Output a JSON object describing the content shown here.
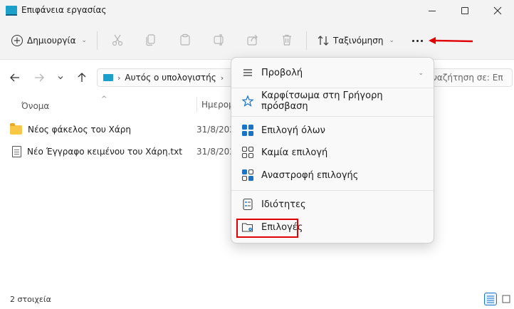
{
  "window": {
    "title": "Επιφάνεια εργασίας"
  },
  "toolbar": {
    "new_label": "Δημιουργία",
    "sort_label": "Ταξινόμηση"
  },
  "addressbar": {
    "path_item": "Αυτός ο υπολογιστής",
    "search_placeholder": "Αναζήτηση σε: Επ"
  },
  "columns": {
    "name": "Όνομα",
    "date": "Ημερομ"
  },
  "files": [
    {
      "name": "Νέος φάκελος του Χάρη",
      "date": "31/8/202",
      "icon": "folder-icon"
    },
    {
      "name": "Νέο Έγγραφο κειμένου του Χάρη.txt",
      "date": "31/8/202",
      "icon": "text-document-icon"
    }
  ],
  "status": {
    "item_count": "2 στοιχεία"
  },
  "menu": {
    "items": [
      {
        "label": "Προβολή",
        "icon": "view-icon"
      },
      {
        "label": "Καρφίτσωμα στη Γρήγορη πρόσβαση",
        "icon": "star-icon"
      },
      {
        "label": "Επιλογή όλων",
        "icon": "select-all-icon"
      },
      {
        "label": "Καμία επιλογή",
        "icon": "select-none-icon"
      },
      {
        "label": "Αναστροφή επιλογής",
        "icon": "invert-selection-icon"
      },
      {
        "label": "Ιδιότητες",
        "icon": "properties-icon"
      },
      {
        "label": "Επιλογές",
        "icon": "folder-options-icon"
      }
    ]
  },
  "colors": {
    "accent": "#1a73c7",
    "annotation": "#e00000",
    "folder": "#f8c845"
  }
}
